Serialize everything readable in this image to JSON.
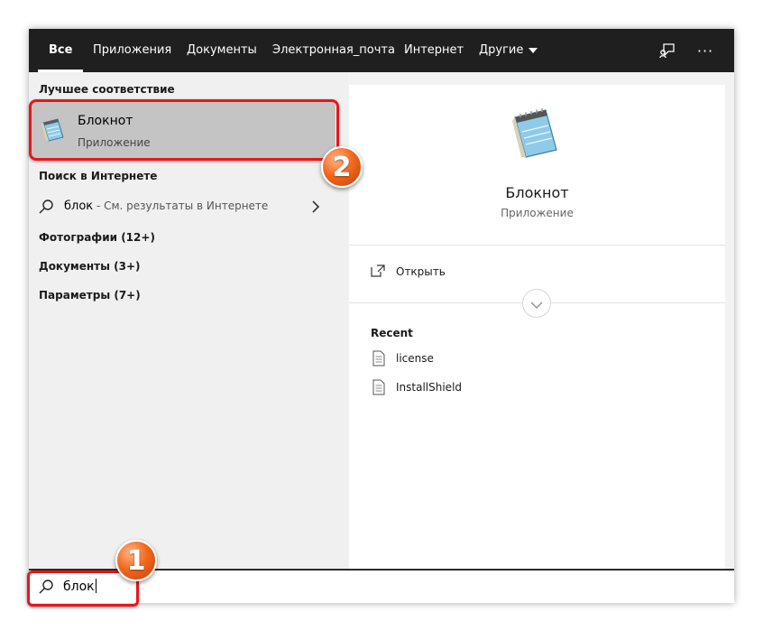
{
  "tabs": [
    {
      "label": "Все",
      "active": true
    },
    {
      "label": "Приложения"
    },
    {
      "label": "Документы"
    },
    {
      "label": "Электронная_почта"
    },
    {
      "label": "Интернет"
    },
    {
      "label": "Другие"
    }
  ],
  "top_icons": [
    "feedback-icon",
    "more-icon"
  ],
  "top_more_label": "···",
  "left": {
    "best_match_header": "Лучшее соответствие",
    "best_match": {
      "title": "Блокнот",
      "subtitle": "Приложение",
      "icon": "notepad-icon"
    },
    "web_header": "Поиск в Интернете",
    "web_result": {
      "query": "блок",
      "hint": " - См. результаты в Интернете"
    },
    "categories": [
      "Фотографии (12+)",
      "Документы (3+)",
      "Параметры (7+)"
    ]
  },
  "right": {
    "app_name": "Блокнот",
    "app_type": "Приложение",
    "action_open": "Открыть",
    "recent_header": "Recent",
    "recent_items": [
      "license",
      "InstallShield"
    ]
  },
  "search": {
    "value": "блок"
  },
  "badges": {
    "one": "1",
    "two": "2"
  },
  "colors": {
    "accent_red": "#e8161b",
    "badge_orange": "#f26a1d",
    "topbar": "#1f1f1f"
  }
}
